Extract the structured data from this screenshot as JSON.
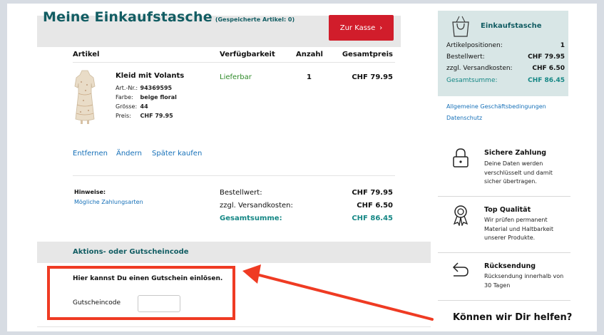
{
  "header": {
    "title": "Meine Einkaufstasche",
    "subtitle": "(Gespeicherte Artikel: 0)",
    "checkout_label": "Zur Kasse",
    "checkout_chevron": "›"
  },
  "table": {
    "columns": [
      "Artikel",
      "Verfügbarkeit",
      "Anzahl",
      "Gesamtpreis"
    ]
  },
  "product": {
    "name": "Kleid mit Volants",
    "specs": [
      {
        "label": "Art.-Nr.:",
        "value": "94369595"
      },
      {
        "label": "Farbe:",
        "value": "beige floral"
      },
      {
        "label": "Grösse:",
        "value": "44"
      },
      {
        "label": "Preis:",
        "value": "CHF 79.95"
      }
    ],
    "availability": "Lieferbar",
    "quantity": "1",
    "total": "CHF 79.95",
    "actions": [
      "Entfernen",
      "Ändern",
      "Später kaufen"
    ]
  },
  "hints": {
    "label": "Hinweise:",
    "payment_link": "Mögliche Zahlungsarten"
  },
  "summary": {
    "order_value_label": "Bestellwert:",
    "order_value": "CHF 79.95",
    "shipping_label": "zzgl. Versandkosten:",
    "shipping": "CHF 6.50",
    "total_label": "Gesamtsumme:",
    "total": "CHF 86.45"
  },
  "voucher": {
    "title": "Aktions- oder Gutscheincode",
    "text": "Hier kannst Du einen Gutschein einlösen.",
    "label": "Gutscheincode",
    "value": ""
  },
  "sidebar": {
    "title": "Einkaufstasche",
    "rows": [
      {
        "label": "Artikelpositionen:",
        "value": "1"
      },
      {
        "label": "Bestellwert:",
        "value": "CHF 79.95"
      },
      {
        "label": "zzgl. Versandkosten:",
        "value": "CHF 6.50"
      },
      {
        "label": "Gesamtsumme:",
        "value": "CHF 86.45"
      }
    ],
    "links": [
      "Allgemeine Geschäftsbedingungen",
      "Datenschutz"
    ],
    "features": [
      {
        "title": "Sichere Zahlung",
        "text": "Deine Daten werden verschlüsselt und damit sicher übertragen.",
        "icon": "lock-icon"
      },
      {
        "title": "Top Qualität",
        "text": "Wir prüfen permanent Material und Haltbarkeit unserer Produkte.",
        "icon": "award-icon"
      },
      {
        "title": "Rücksendung",
        "text": "Rücksendung innerhalb von 30 Tagen",
        "icon": "return-arrow-icon"
      }
    ],
    "help_title": "Können wir Dir helfen?"
  },
  "colors": {
    "brand_teal": "#125d63",
    "accent_teal": "#158785",
    "checkout_red": "#d11d2b",
    "annotation_red": "#ef3b23",
    "link_blue": "#1670b8",
    "available_green": "#2f8a2a"
  }
}
